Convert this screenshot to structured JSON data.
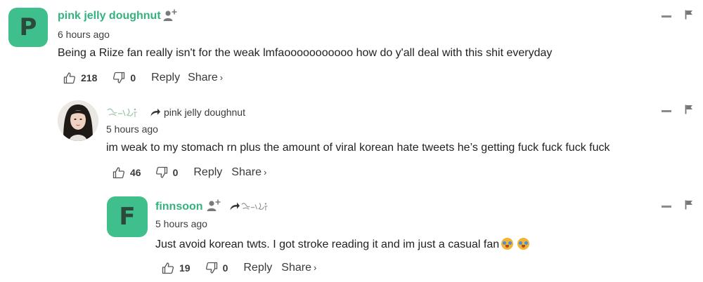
{
  "comments": [
    {
      "avatar_letter": "P",
      "name": "pink jelly doughnut",
      "time": "6 hours ago",
      "text": "Being a Riize fan really isn't for the weak lmfaooooooooooo how do y'all deal with this shit everyday",
      "likes": "218",
      "dislikes": "0",
      "reply_label": "Reply",
      "share_label": "Share",
      "share_chevron": "›"
    },
    {
      "avatar": "photo-avatar",
      "reply_to": "pink jelly doughnut",
      "time": "5 hours ago",
      "text": "im weak to my stomach rn plus the amount of viral korean hate tweets he’s getting fuck fuck fuck fuck",
      "likes": "46",
      "dislikes": "0",
      "reply_label": "Reply",
      "share_label": "Share",
      "share_chevron": "›"
    },
    {
      "avatar_letter": "F",
      "name": "finnsoon",
      "time": "5 hours ago",
      "text": "Just avoid korean twts. I got stroke reading it and im just a casual fan",
      "emojis": [
        "crying-face-emoji",
        "crying-face-emoji"
      ],
      "likes": "19",
      "dislikes": "0",
      "reply_label": "Reply",
      "share_label": "Share",
      "share_chevron": "›"
    }
  ],
  "colors": {
    "accent": "#3fbf8c",
    "name": "#34b27e",
    "text": "#222222",
    "muted": "#3d3d3d",
    "icon": "#8a8a8a"
  },
  "icons": {
    "like": "thumbs-up-icon",
    "dislike": "thumbs-down-icon",
    "collapse": "minus-icon",
    "report": "flag-icon",
    "follow": "add-user-icon",
    "reply_arrow": "reply-arrow-icon"
  }
}
